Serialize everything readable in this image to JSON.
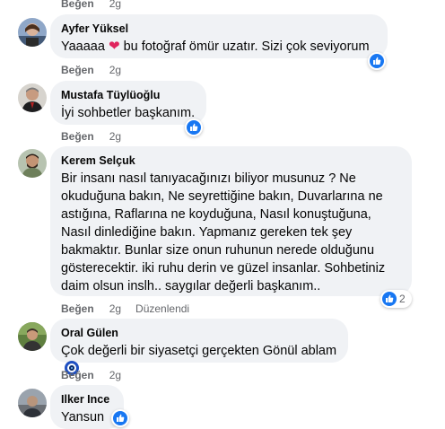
{
  "labels": {
    "like": "Beğen",
    "edited": "Düzenlendi"
  },
  "comments": [
    {
      "author": "",
      "text": "",
      "time": "2g"
    },
    {
      "author": "Ayfer Yüksel",
      "text_before": "Yaaaaa",
      "text_after": "bu fotoğraf ömür uzatır. Sizi çok seviyorum",
      "time": "2g",
      "reaction": "like"
    },
    {
      "author": "Mustafa Tüylüoğlu",
      "text": "İyi sohbetler başkanım.",
      "time": "2g",
      "reaction": "like"
    },
    {
      "author": "Kerem Selçuk",
      "text": "Bir insanı nasıl tanıyacağınızı biliyor musunuz ? Ne okuduğuna bakın, Ne seyrettiğine bakın, Duvarlarına ne astığına, Raflarına ne koyduğuna, Nasıl konuştuğuna, Nasıl dinlediğine bakın. Yapmanız gereken tek şey bakmaktır. Bunlar size onun ruhunun nerede olduğunu gösterecektir. iki ruhu derin ve güzel insanlar. Sohbetiniz daim olsun inslh.. saygılar değerli başkanım..",
      "time": "2g",
      "edited": true,
      "reaction": "like",
      "reaction_count": "2"
    },
    {
      "author": "Oral Gülen",
      "text": "Çok değerli bir siyasetçi gerçekten Gönül ablam",
      "time": "2g"
    },
    {
      "author": "Ilker Ince",
      "text": "Yansun",
      "reaction": "like"
    }
  ],
  "icons": {
    "like": "thumbs-up-icon",
    "heart": "red-heart-emoji",
    "nazar": "evil-eye-emoji"
  },
  "colors": {
    "like_blue": "#1877f2",
    "bubble": "#f0f2f5",
    "meta": "#65676b",
    "heart": "#e0245e"
  }
}
